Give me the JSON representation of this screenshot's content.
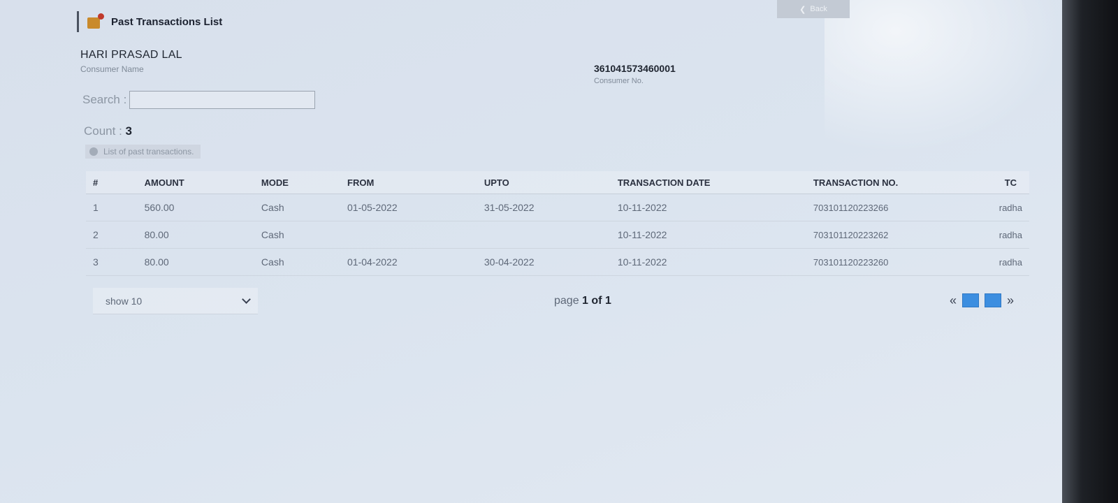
{
  "header": {
    "title": "Past Transactions List",
    "back_label": "Back"
  },
  "consumer": {
    "name": "HARI PRASAD LAL",
    "name_label": "Consumer Name",
    "number": "361041573460001",
    "number_label": "Consumer No."
  },
  "search": {
    "label": "Search :",
    "value": ""
  },
  "count": {
    "label": "Count :",
    "value": "3"
  },
  "note": "List of past transactions.",
  "table": {
    "columns": [
      "#",
      "AMOUNT",
      "MODE",
      "FROM",
      "UPTO",
      "TRANSACTION DATE",
      "TRANSACTION NO.",
      "TC"
    ],
    "rows": [
      {
        "idx": "1",
        "amount": "560.00",
        "mode": "Cash",
        "from": "01-05-2022",
        "upto": "31-05-2022",
        "date": "10-11-2022",
        "txn": "703101120223266",
        "tc": "radha"
      },
      {
        "idx": "2",
        "amount": "80.00",
        "mode": "Cash",
        "from": "",
        "upto": "",
        "date": "10-11-2022",
        "txn": "703101120223262",
        "tc": "radha"
      },
      {
        "idx": "3",
        "amount": "80.00",
        "mode": "Cash",
        "from": "01-04-2022",
        "upto": "30-04-2022",
        "date": "10-11-2022",
        "txn": "703101120223260",
        "tc": "radha"
      }
    ]
  },
  "pager": {
    "show_label": "show 10",
    "page_prefix": "page",
    "page_current": "1",
    "page_sep": "of",
    "page_total": "1",
    "prev_symbol": "«",
    "next_symbol": "»"
  },
  "colors": {
    "accent": "#3c8ee0",
    "background": "#d9e2ee"
  }
}
